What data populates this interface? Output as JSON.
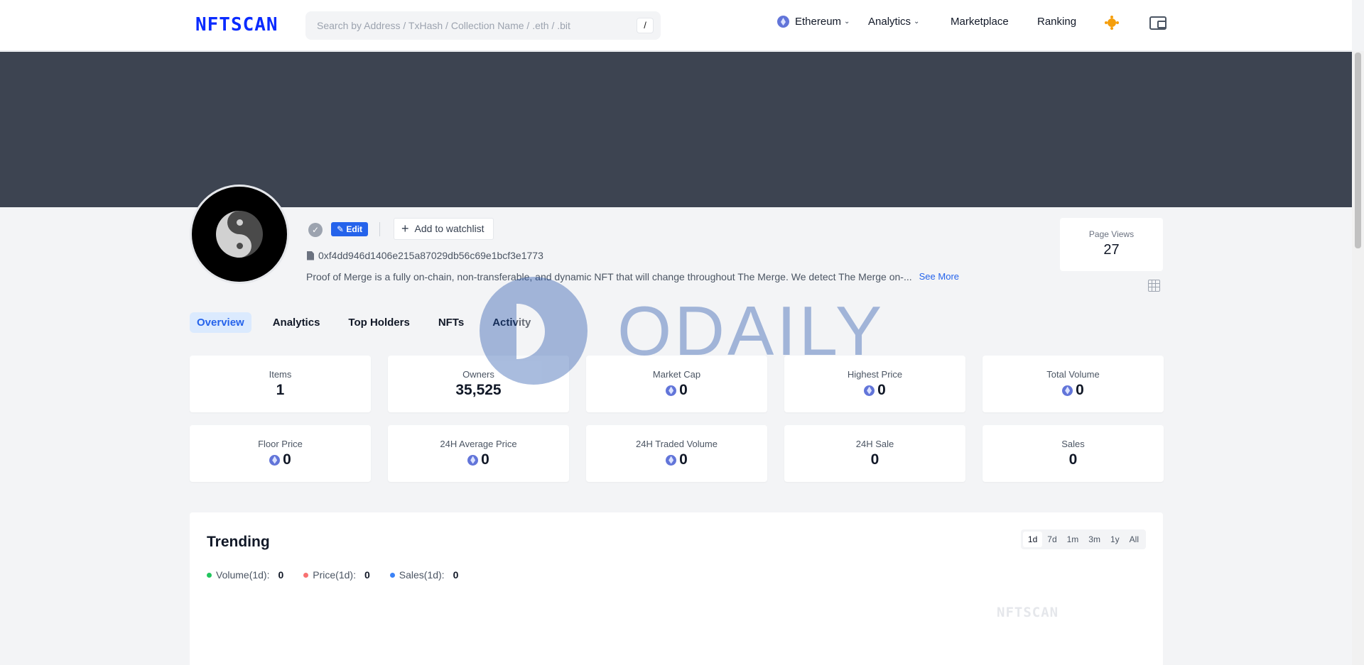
{
  "header": {
    "logo": "NFTSCAN",
    "search_placeholder": "Search by Address / TxHash / Collection Name / .eth / .bit",
    "search_shortcut": "/",
    "nav": {
      "chain": "Ethereum",
      "analytics": "Analytics",
      "marketplace": "Marketplace",
      "ranking": "Ranking"
    }
  },
  "collection": {
    "edit_label": "Edit",
    "watchlist_label": "Add to watchlist",
    "contract_address": "0xf4dd946d1406e215a87029db56c69e1bcf3e1773",
    "description": "Proof of Merge is a fully on-chain, non-transferable, and dynamic NFT that will change throughout The Merge. We detect The Merge on-...",
    "see_more": "See More",
    "page_views_label": "Page Views",
    "page_views_value": "27"
  },
  "watermark": "ODAILY",
  "tabs": [
    "Overview",
    "Analytics",
    "Top Holders",
    "NFTs",
    "Activity"
  ],
  "stats_row1": [
    {
      "label": "Items",
      "value": "1",
      "eth": false
    },
    {
      "label": "Owners",
      "value": "35,525",
      "eth": false
    },
    {
      "label": "Market Cap",
      "value": "0",
      "eth": true
    },
    {
      "label": "Highest Price",
      "value": "0",
      "eth": true
    },
    {
      "label": "Total Volume",
      "value": "0",
      "eth": true
    }
  ],
  "stats_row2": [
    {
      "label": "Floor Price",
      "value": "0",
      "eth": true
    },
    {
      "label": "24H Average Price",
      "value": "0",
      "eth": true
    },
    {
      "label": "24H Traded Volume",
      "value": "0",
      "eth": true
    },
    {
      "label": "24H Sale",
      "value": "0",
      "eth": false
    },
    {
      "label": "Sales",
      "value": "0",
      "eth": false
    }
  ],
  "trending": {
    "title": "Trending",
    "periods": [
      "1d",
      "7d",
      "1m",
      "3m",
      "1y",
      "All"
    ],
    "active_period": "1d",
    "legend": [
      {
        "label": "Volume(1d):",
        "value": "0",
        "color": "#22c55e"
      },
      {
        "label": "Price(1d):",
        "value": "0",
        "color": "#f87171"
      },
      {
        "label": "Sales(1d):",
        "value": "0",
        "color": "#3b82f6"
      }
    ],
    "chart_watermark": "NFTSCAN"
  },
  "icons": {
    "chain_icon": "ethereum-icon",
    "theme_icon": "sun-icon",
    "wallet_icon": "wallet-icon",
    "verified_icon": "check-badge-icon",
    "address_icon": "document-icon",
    "view_icon": "grid-icon"
  }
}
